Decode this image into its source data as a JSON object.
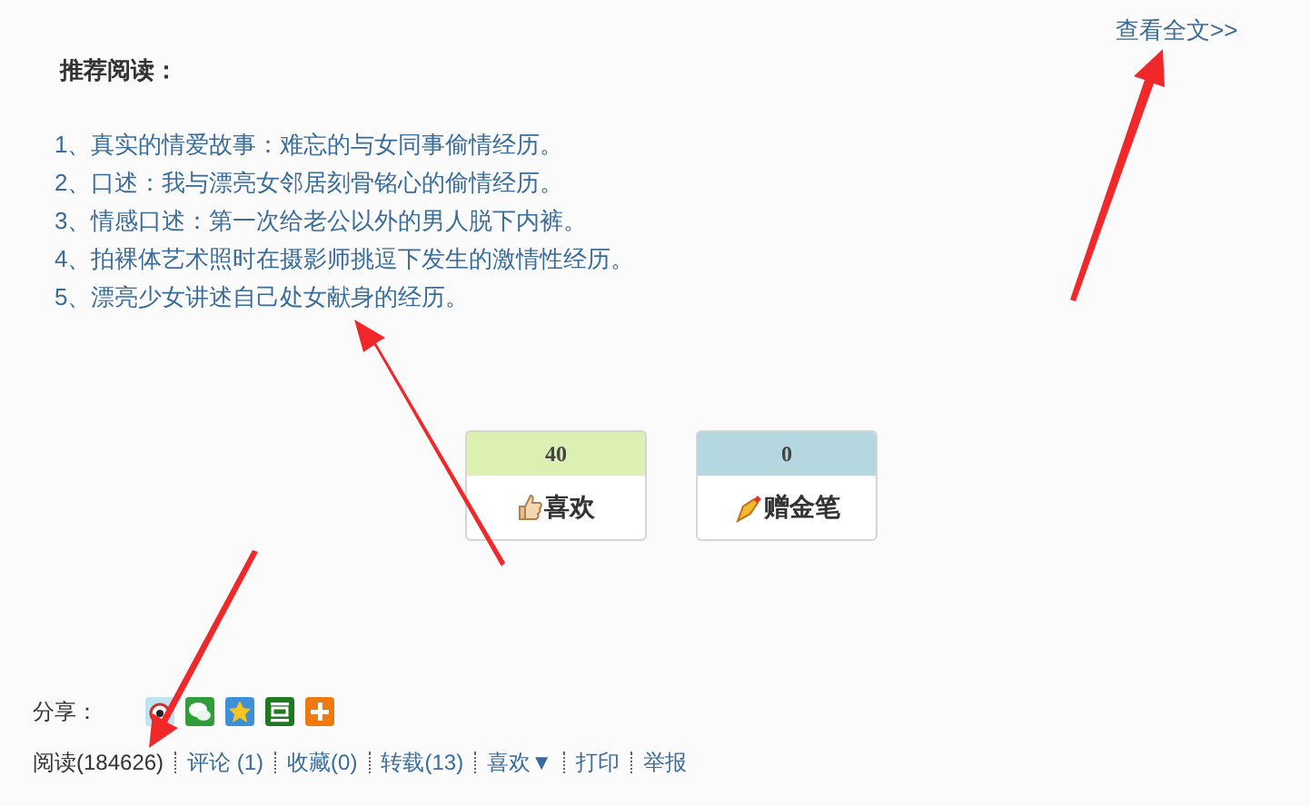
{
  "full_text_link": "查看全文>>",
  "recommend": {
    "title": "推荐阅读：",
    "items": [
      {
        "number": "1、",
        "title": "真实的情爱故事：难忘的与女同事偷情经历。"
      },
      {
        "number": "2、",
        "title": "口述：我与漂亮女邻居刻骨铭心的偷情经历。"
      },
      {
        "number": "3、",
        "title": "情感口述：第一次给老公以外的男人脱下内裤。"
      },
      {
        "number": "4、",
        "title": "拍裸体艺术照时在摄影师挑逗下发生的激情性经历。"
      },
      {
        "number": "5、",
        "title": "漂亮少女讲述自己处女献身的经历。"
      }
    ]
  },
  "votes": [
    {
      "kind": "like",
      "count": "40",
      "label": "喜欢",
      "color": "#dcf0b4"
    },
    {
      "kind": "pen",
      "count": "0",
      "label": "赠金笔",
      "color": "#b5d8e0"
    }
  ],
  "share": {
    "label": "分享：",
    "icons": [
      {
        "kind": "weibo"
      },
      {
        "kind": "wechat"
      },
      {
        "kind": "qzone"
      },
      {
        "kind": "douban"
      },
      {
        "kind": "more"
      }
    ]
  },
  "actions": [
    {
      "kind": "plain",
      "label": "阅读",
      "count": "(184626)"
    },
    {
      "kind": "link",
      "label": "评论",
      "count": " (1)"
    },
    {
      "kind": "link",
      "label": "收藏",
      "count": "(0)"
    },
    {
      "kind": "link",
      "label": "转载",
      "count": "(13)"
    },
    {
      "kind": "menu",
      "label": "喜欢▼"
    },
    {
      "kind": "link",
      "label": "打印"
    },
    {
      "kind": "link",
      "label": "举报"
    }
  ]
}
